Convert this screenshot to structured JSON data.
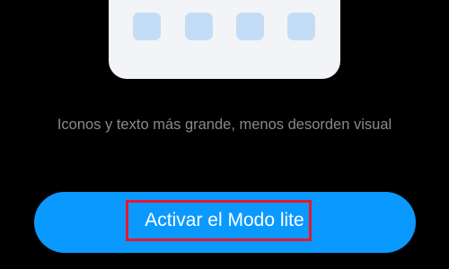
{
  "preview": {
    "card_color": "#f2f4f7",
    "icons": [
      {
        "icon": "app-placeholder-icon",
        "color": "#c4ddf6"
      },
      {
        "icon": "app-placeholder-icon",
        "color": "#c4ddf6"
      },
      {
        "icon": "app-placeholder-icon",
        "color": "#c4ddf6"
      },
      {
        "icon": "app-placeholder-icon",
        "color": "#c4ddf6"
      }
    ]
  },
  "description": "Iconos y texto más grande, menos desorden visual",
  "action": {
    "label": "Activar el Modo lite",
    "button_color": "#0a99ff",
    "highlight_color": "#e8182c"
  },
  "background_color": "#000000"
}
